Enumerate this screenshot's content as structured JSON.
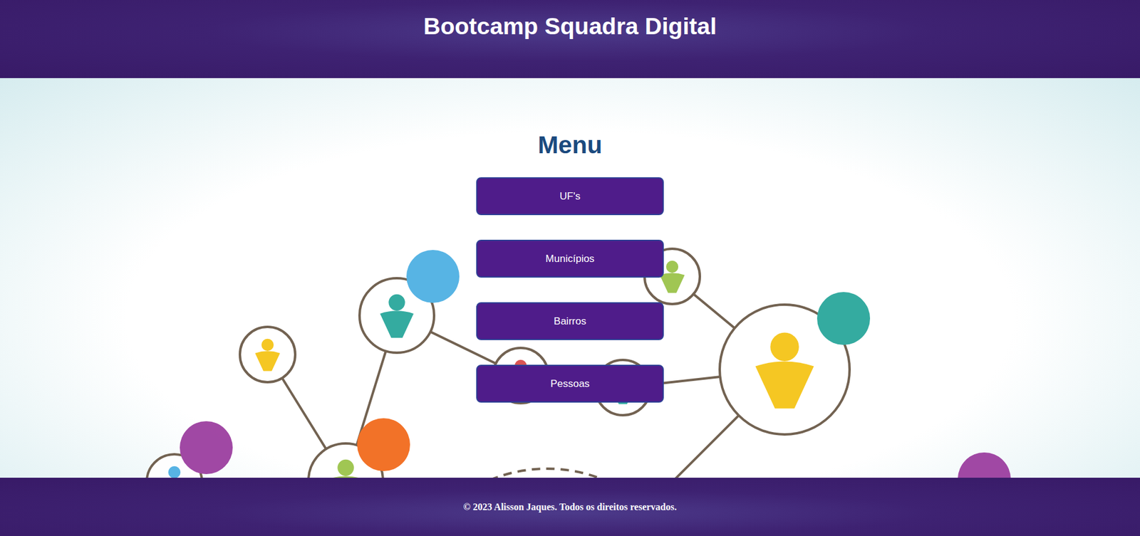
{
  "header": {
    "title": "Bootcamp Squadra Digital"
  },
  "menu": {
    "title": "Menu",
    "buttons": [
      "UF's",
      "Municípios",
      "Bairros",
      "Pessoas"
    ]
  },
  "footer": {
    "text": "© 2023 Alisson Jaques. Todos os direitos reservados."
  }
}
